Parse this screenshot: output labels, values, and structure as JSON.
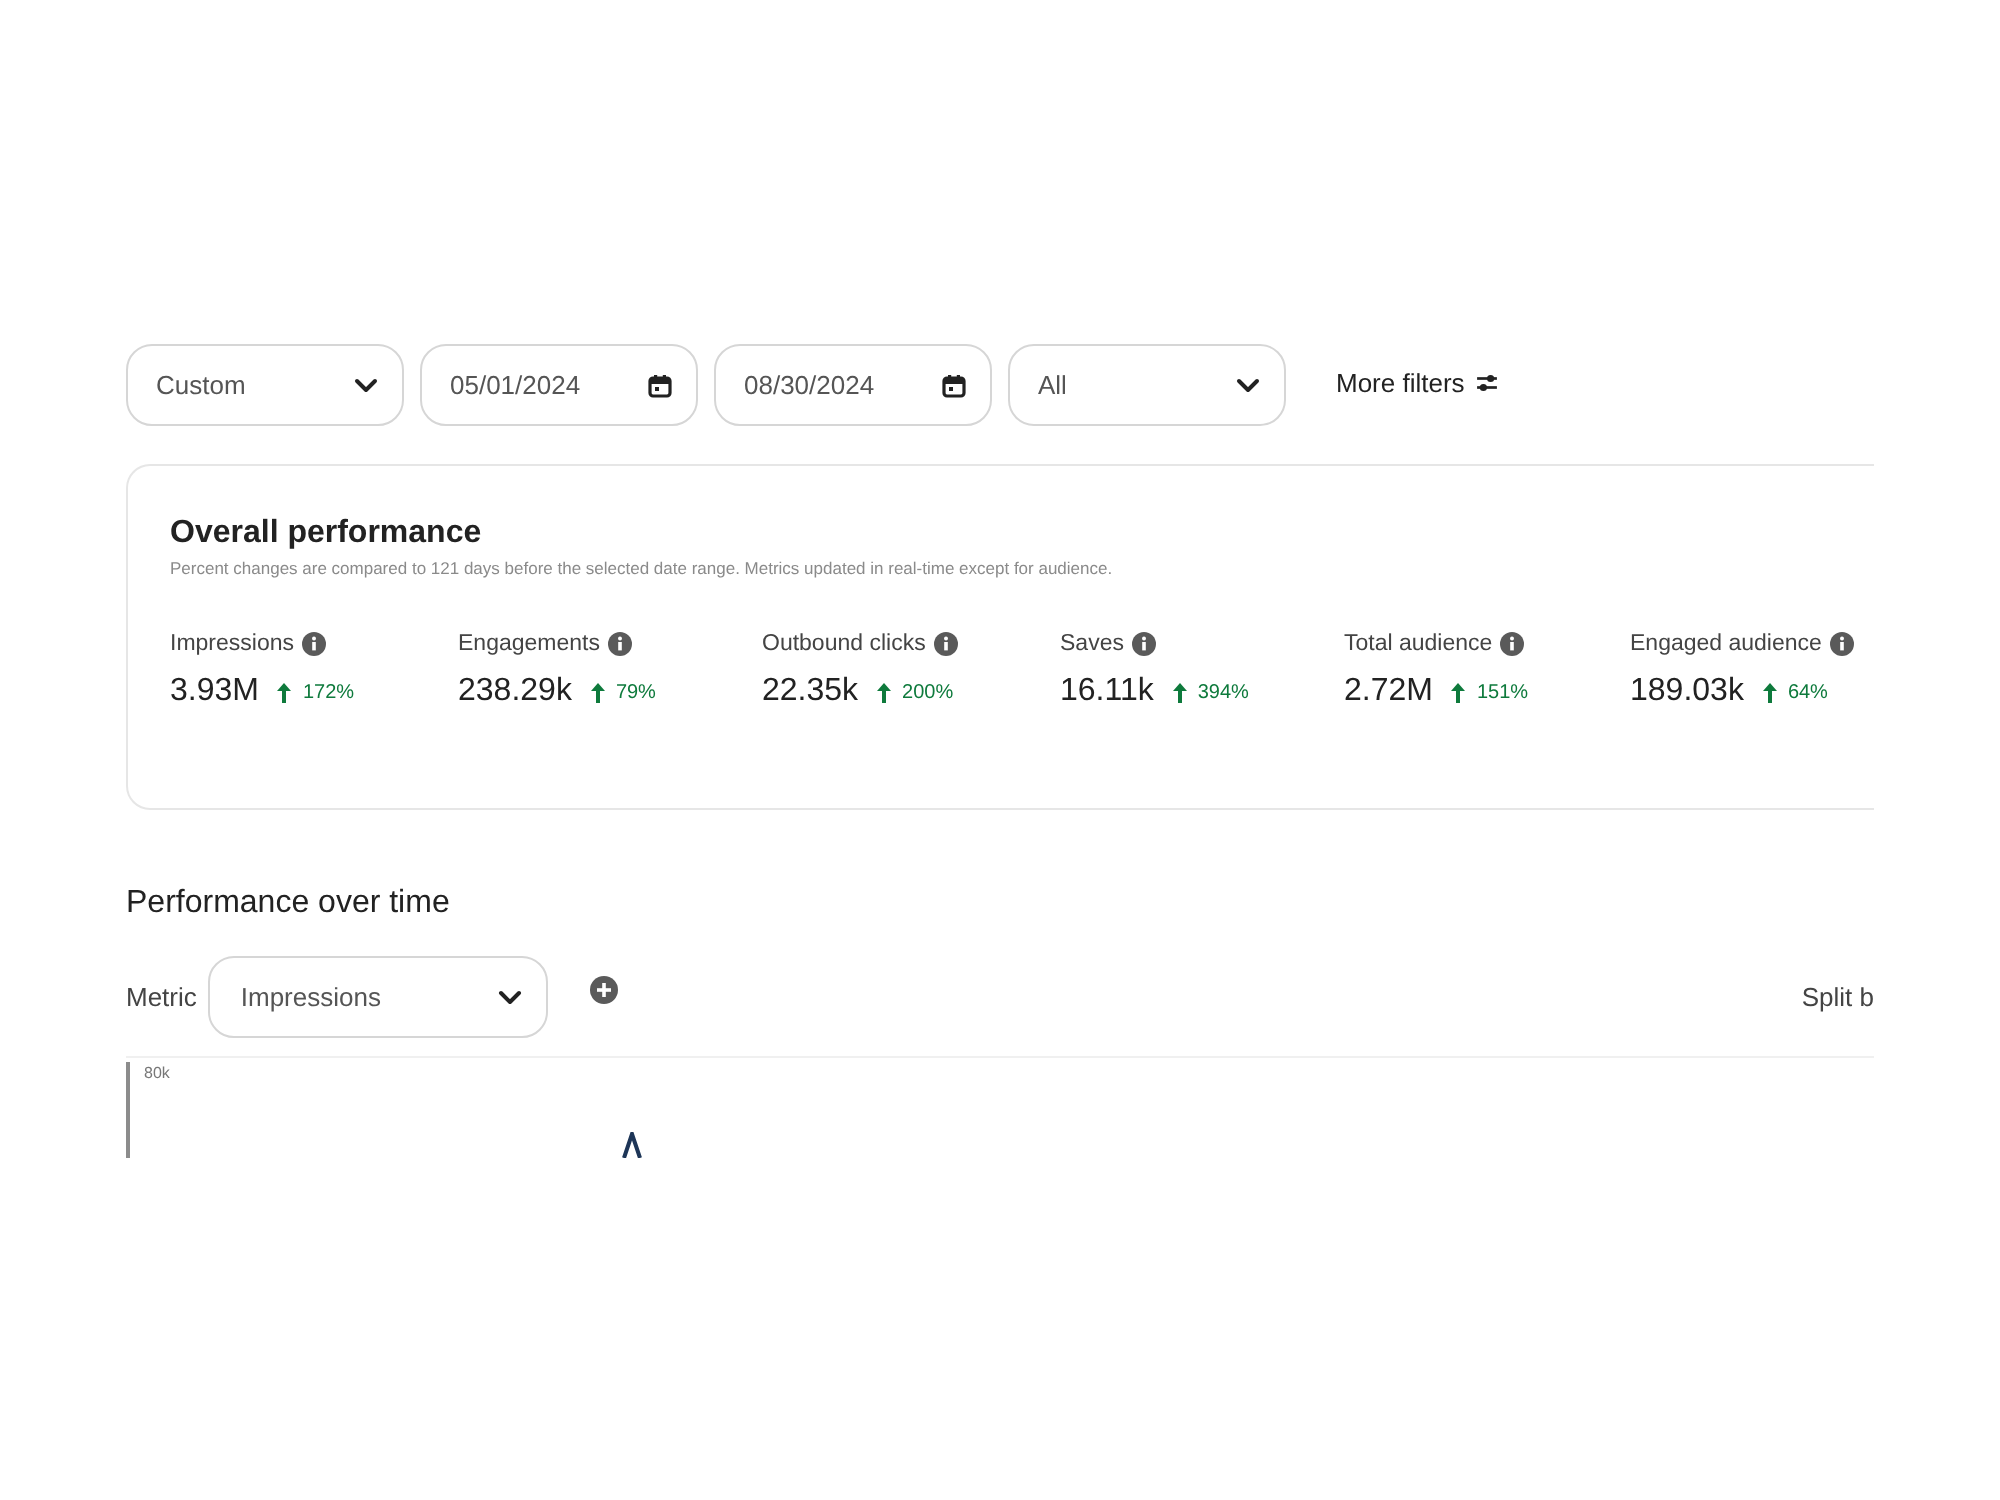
{
  "filters": [
    {
      "kind": "select",
      "value": "Custom"
    },
    {
      "kind": "date",
      "value": "05/01/2024"
    },
    {
      "kind": "date",
      "value": "08/30/2024"
    },
    {
      "kind": "select",
      "value": "All"
    }
  ],
  "more_filters": {
    "label": "More filters"
  },
  "overall": {
    "title": "Overall performance",
    "note": "Percent changes are compared to 121 days before the selected date range. Metrics updated in real-time except for audience.",
    "metrics": [
      {
        "label": "Impressions",
        "value": "3.93M",
        "increase": true,
        "change": "172%"
      },
      {
        "label": "Engagements",
        "value": "238.29k",
        "increase": true,
        "change": "79%"
      },
      {
        "label": "Outbound clicks",
        "value": "22.35k",
        "increase": true,
        "change": "200%"
      },
      {
        "label": "Saves",
        "value": "16.11k",
        "increase": true,
        "change": "394%"
      },
      {
        "label": "Total audience",
        "value": "2.72M",
        "increase": true,
        "change": "151%"
      },
      {
        "label": "Engaged audience",
        "value": "189.03k",
        "increase": true,
        "change": "64%"
      }
    ]
  },
  "performance": {
    "title": "Performance over time",
    "metric_label": "Metric",
    "metric": {
      "value": "Impressions"
    },
    "split_by": "Split b",
    "y_tick": "80k"
  }
}
